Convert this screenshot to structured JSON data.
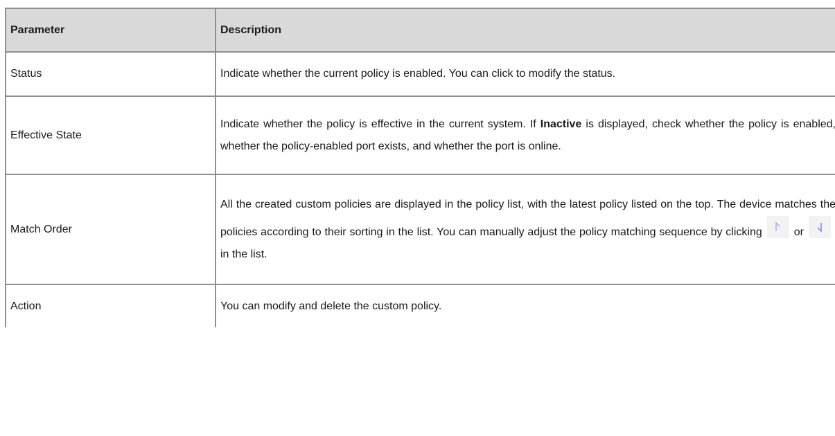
{
  "table": {
    "headers": [
      "Parameter",
      "Description"
    ],
    "rows": [
      {
        "param": "Status",
        "desc": "Indicate whether the current policy is enabled. You can click to modify the status."
      },
      {
        "param": "Effective State",
        "desc_before": "Indicate whether the policy is effective in the current system. If ",
        "desc_bold": "Inactive",
        "desc_after": " is displayed, check whether the policy is enabled, whether the policy-enabled port exists, and whether the port is online."
      },
      {
        "param": "Match Order",
        "desc_before": "All the created custom policies are displayed in the policy list, with the latest policy listed on the top. The device matches the policies according to their sorting in the list. You can manually adjust the policy matching sequence by clicking",
        "desc_or": "or",
        "desc_after": "in the list.",
        "icons": [
          "arrow-up-icon",
          "arrow-down-icon"
        ]
      },
      {
        "param": "Action",
        "desc": "You can modify and delete the custom policy."
      }
    ]
  }
}
